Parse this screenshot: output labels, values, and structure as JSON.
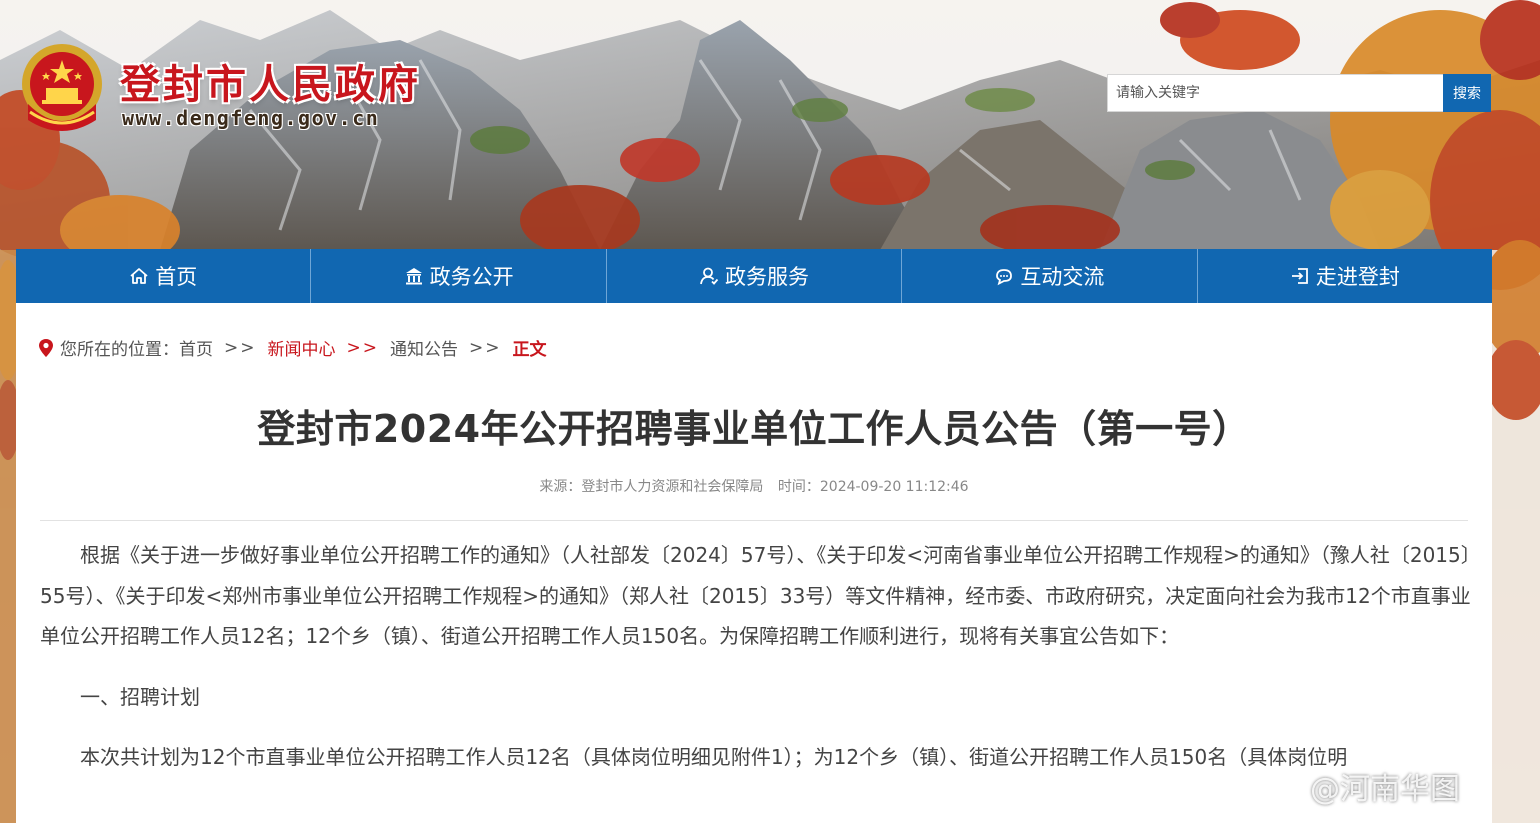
{
  "header": {
    "site_title": "登封市人民政府",
    "site_url": "www.dengfeng.gov.cn"
  },
  "search": {
    "placeholder": "请输入关键字",
    "button_label": "搜索"
  },
  "nav": {
    "items": [
      {
        "label": "首页",
        "icon": "home-icon"
      },
      {
        "label": "政务公开",
        "icon": "government-building-icon"
      },
      {
        "label": "政务服务",
        "icon": "service-person-icon"
      },
      {
        "label": "互动交流",
        "icon": "chat-bubble-icon"
      },
      {
        "label": "走进登封",
        "icon": "enter-icon"
      }
    ]
  },
  "breadcrumb": {
    "prefix": "您所在的位置：",
    "items": [
      "首页",
      "新闻中心",
      "通知公告",
      "正文"
    ],
    "separator": ">>"
  },
  "article": {
    "title": "登封市2024年公开招聘事业单位工作人员公告（第一号）",
    "source_label": "来源：登封市人力资源和社会保障局",
    "time_label": "时间：2024-09-20 11:12:46",
    "paragraphs": [
      "根据《关于进一步做好事业单位公开招聘工作的通知》（人社部发〔2024〕57号）、《关于印发<河南省事业单位公开招聘工作规程>的通知》（豫人社〔2015〕55号）、《关于印发<郑州市事业单位公开招聘工作规程>的通知》（郑人社〔2015〕33号）等文件精神，经市委、市政府研究，决定面向社会为我市12个市直事业单位公开招聘工作人员12名；12个乡（镇）、街道公开招聘工作人员150名。为保障招聘工作顺利进行，现将有关事宜公告如下：",
      "一、招聘计划",
      "本次共计划为12个市直事业单位公开招聘工作人员12名（具体岗位明细见附件1）；为12个乡（镇）、街道公开招聘工作人员150名（具体岗位明"
    ]
  },
  "watermark": {
    "text": "@河南华图"
  },
  "colors": {
    "brand_blue": "#1167b1",
    "title_red": "#c8161d"
  }
}
